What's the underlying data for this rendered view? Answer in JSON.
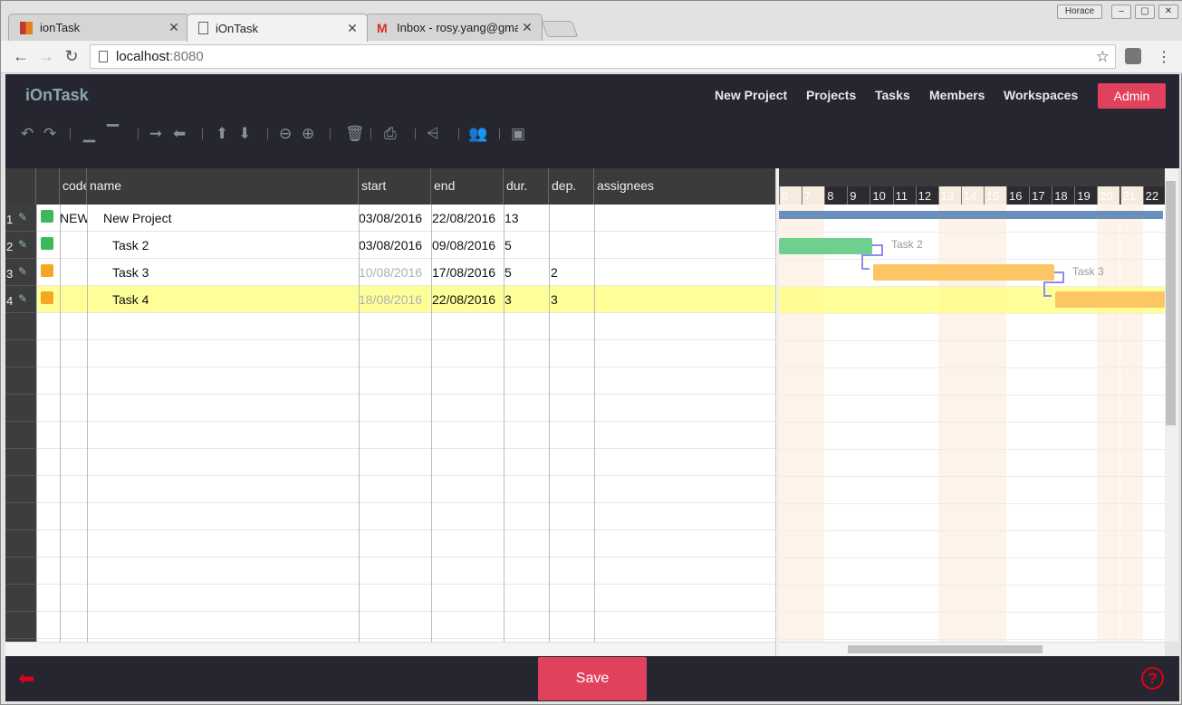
{
  "browser": {
    "tabs": [
      {
        "label": "ionTask",
        "icon": "iontask-favicon"
      },
      {
        "label": "iOnTask",
        "icon": "page-icon"
      },
      {
        "label": "Inbox - rosy.yang@gma",
        "icon": "gmail-icon"
      }
    ],
    "profile": "Horace",
    "url_host": "localhost",
    "url_port": ":8080"
  },
  "app": {
    "brand": "iOnTask",
    "nav": [
      "New Project",
      "Projects",
      "Tasks",
      "Members",
      "Workspaces"
    ],
    "admin": "Admin",
    "save": "Save"
  },
  "grid": {
    "headers": [
      "code",
      "name",
      "start",
      "end",
      "dur.",
      "dep.",
      "assignees"
    ],
    "rows": [
      {
        "num": "1",
        "status_color": "#3cb95a",
        "code": "NEW",
        "name": "New Project",
        "start": "03/08/2016",
        "end": "22/08/2016",
        "dur": "13",
        "dep": "",
        "start_dim": false
      },
      {
        "num": "2",
        "status_color": "#3cb95a",
        "code": "",
        "name": "Task 2",
        "start": "03/08/2016",
        "end": "09/08/2016",
        "dur": "5",
        "dep": "",
        "start_dim": false
      },
      {
        "num": "3",
        "status_color": "#f5a623",
        "code": "",
        "name": "Task 3",
        "start": "10/08/2016",
        "end": "17/08/2016",
        "dur": "5",
        "dep": "2",
        "start_dim": true
      },
      {
        "num": "4",
        "status_color": "#f5a623",
        "code": "",
        "name": "Task 4",
        "start": "18/08/2016",
        "end": "22/08/2016",
        "dur": "3",
        "dep": "3",
        "start_dim": true
      }
    ]
  },
  "gantt": {
    "days": [
      "6",
      "7",
      "8",
      "9",
      "10",
      "11",
      "12",
      "13",
      "14",
      "15",
      "16",
      "17",
      "18",
      "19",
      "20",
      "21",
      "22"
    ],
    "weekend": [
      "6",
      "7",
      "13",
      "14",
      "15",
      "20",
      "21"
    ],
    "labels": [
      "Task 2",
      "Task 3"
    ],
    "colors": {
      "project": "#6a8fbb",
      "task_green": "#6fcf8f",
      "task_orange": "#fdc563",
      "link": "#8d8df0"
    }
  }
}
